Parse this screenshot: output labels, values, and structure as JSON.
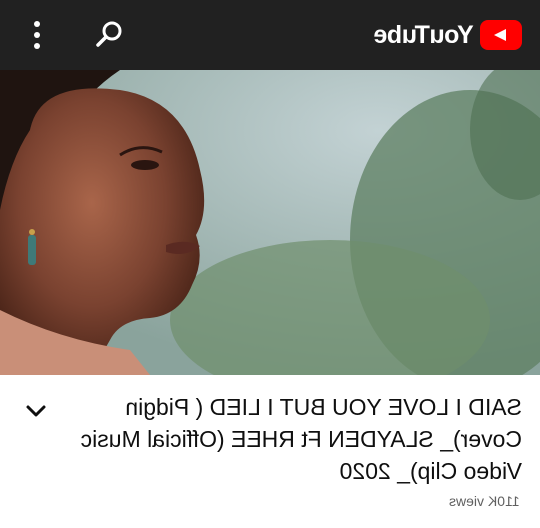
{
  "header": {
    "brand": "YouTube",
    "brand_color": "#ff0000",
    "icons": [
      "more-vert-icon",
      "search-icon",
      "youtube-play-logo-icon"
    ]
  },
  "video": {
    "title": "SAID I LOVE YOU BUT I LIED ( Pidgin Cover)_ SLAYDEN Ft RHEE (Official Music Video Clip)_ 2020",
    "views": "110K views"
  }
}
